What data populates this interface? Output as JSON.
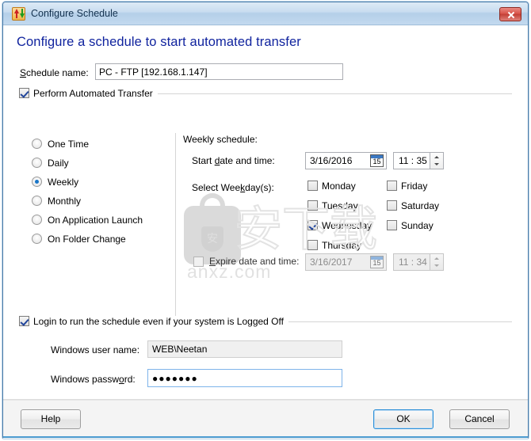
{
  "window": {
    "title": "Configure Schedule",
    "icon": "transfer-arrows-icon",
    "close_label": "",
    "accent_color": "#4b9bd0",
    "heading_color": "#10239e"
  },
  "heading": "Configure a schedule to start automated transfer",
  "schedule_name": {
    "label": "Schedule name:",
    "value": "PC - FTP [192.168.1.147]",
    "placeholder": ""
  },
  "perform_transfer": {
    "label": "Perform Automated Transfer",
    "checked": true
  },
  "frequency": {
    "selected": "Weekly",
    "options": [
      {
        "label": "One Time",
        "selected": false
      },
      {
        "label": "Daily",
        "selected": false
      },
      {
        "label": "Weekly",
        "selected": true
      },
      {
        "label": "Monthly",
        "selected": false
      },
      {
        "label": "On Application Launch",
        "selected": false
      },
      {
        "label": "On Folder Change",
        "selected": false
      }
    ]
  },
  "weekly": {
    "title": "Weekly schedule:",
    "start_label": "Start date and time:",
    "start_date": "3/16/2016",
    "start_time": "11 : 35",
    "calendar_icon_day": "15",
    "weekday_label": "Select Weekday(s):",
    "weekdays": [
      {
        "label": "Monday",
        "checked": false
      },
      {
        "label": "Tuesday",
        "checked": false
      },
      {
        "label": "Wednesday",
        "checked": true
      },
      {
        "label": "Thursday",
        "checked": false
      },
      {
        "label": "Friday",
        "checked": false
      },
      {
        "label": "Saturday",
        "checked": false
      },
      {
        "label": "Sunday",
        "checked": false
      }
    ],
    "expire": {
      "label": "Expire date and time:",
      "checked": false,
      "enabled": false,
      "date": "3/16/2017",
      "time": "11 : 34",
      "calendar_icon_day": "15"
    }
  },
  "login": {
    "label": "Login to run the schedule even if your system is Logged Off",
    "checked": true,
    "username_label": "Windows user name:",
    "username_value": "WEB\\Neetan",
    "password_label": "Windows password:",
    "password_value": "●●●●●●●"
  },
  "footer": {
    "help_label": "Help",
    "ok_label": "OK",
    "cancel_label": "Cancel"
  },
  "watermark": {
    "cn_text": "安下载",
    "shield_text": "安",
    "url": "anxz.com"
  }
}
